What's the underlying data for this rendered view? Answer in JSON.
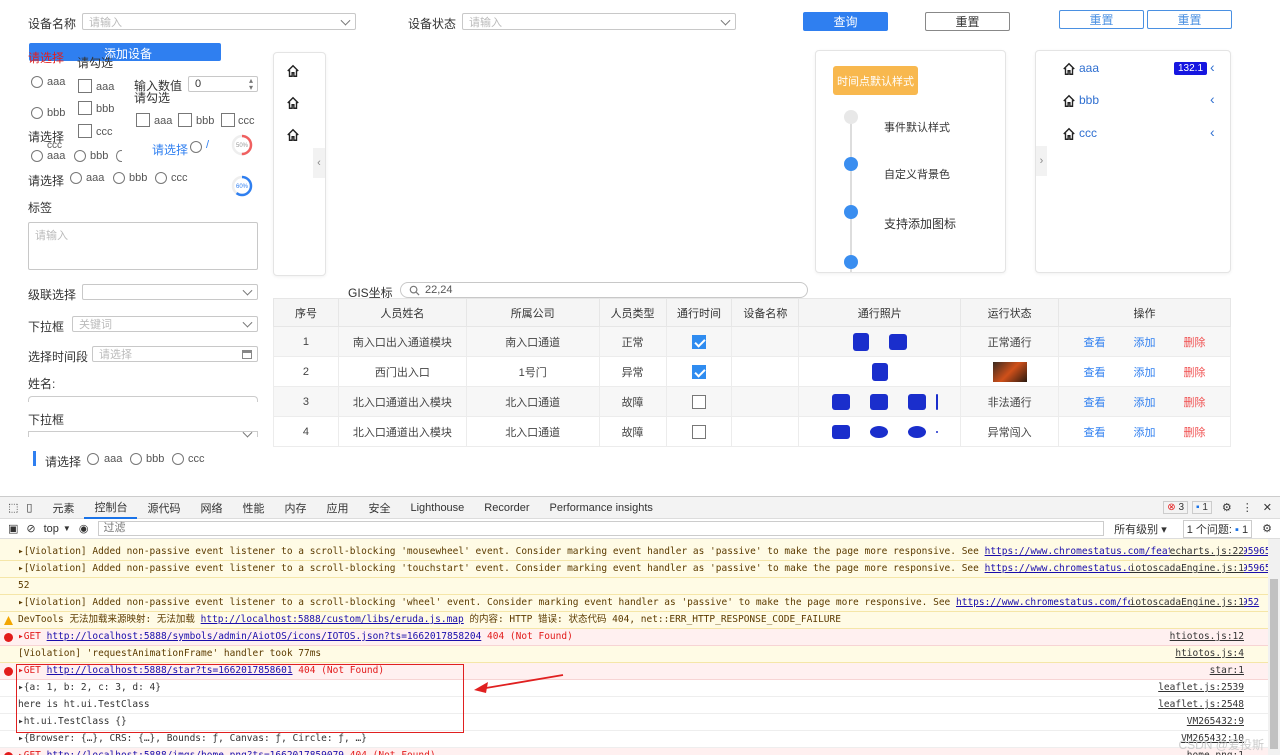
{
  "search": {
    "device_name_label": "设备名称",
    "device_name_placeholder": "请输入",
    "device_status_label": "设备状态",
    "device_status_placeholder": "请输入",
    "query_button": "查询",
    "reset_button": "重置",
    "reset_button_2": "重置",
    "reset_button_3": "重置"
  },
  "form": {
    "select_label_red": "请选择",
    "add_device_button": "添加设备",
    "checkbox_group_label": "请勾选",
    "radio_options": [
      "aaa",
      "bbb"
    ],
    "checkbox_options": [
      "aaa",
      "bbb",
      "ccc"
    ],
    "number_input_label": "输入数值",
    "number_value": "0",
    "checkbox_group_label_2": "请勾选",
    "checkbox_row": [
      "aaa",
      "bbb",
      "ccc"
    ],
    "select_label_2": "请选择",
    "radio_row_a": [
      "ccc",
      "aaa",
      "bbb"
    ],
    "select_link": "请选择",
    "progress_1": "50%",
    "progress_1_value": 50,
    "progress_2": "60%",
    "progress_2_value": 60,
    "select_label_3": "请选择",
    "radio_row_b": [
      "aaa",
      "bbb",
      "ccc"
    ],
    "tag_label": "标签",
    "textarea_placeholder": "请输入",
    "cascade_label": "级联选择",
    "dropdown_label": "下拉框",
    "dropdown_placeholder": "关键词",
    "date_label": "选择时间段",
    "date_placeholder": "请选择",
    "name_label": "姓名:",
    "dropdown_label_2": "下拉框",
    "select_label_4": "请选择",
    "radio_row_c": [
      "aaa",
      "bbb",
      "ccc"
    ]
  },
  "timeline": {
    "tag": "时间点默认样式",
    "items": [
      "事件默认样式",
      "自定义背景色",
      "支持添加图标"
    ],
    "tag_color": "#f8b84e"
  },
  "nav_card": {
    "items": [
      {
        "label": "aaa",
        "badge": "132.1"
      },
      {
        "label": "bbb",
        "badge": ""
      },
      {
        "label": "ccc",
        "badge": ""
      }
    ]
  },
  "gis": {
    "label": "GIS坐标",
    "value": "22,24"
  },
  "table": {
    "headers": [
      "序号",
      "人员姓名",
      "所属公司",
      "人员类型",
      "通行时间",
      "设备名称",
      "通行照片",
      "运行状态",
      "操作"
    ],
    "rows": [
      {
        "no": "1",
        "name": "南入口出入通道模块",
        "company": "南入口通道",
        "type": "正常",
        "checked": true,
        "status": "正常通行"
      },
      {
        "no": "2",
        "name": "西门出入口",
        "company": "1号门",
        "type": "异常",
        "checked": true,
        "status": ""
      },
      {
        "no": "3",
        "name": "北入口通道出入模块",
        "company": "北入口通道",
        "type": "故障",
        "checked": false,
        "status": "非法通行"
      },
      {
        "no": "4",
        "name": "北入口通道出入模块",
        "company": "北入口通道",
        "type": "故障",
        "checked": false,
        "status": "异常闯入"
      }
    ],
    "actions": [
      "查看",
      "添加",
      "删除"
    ]
  },
  "devtools": {
    "tabs": [
      "元素",
      "控制台",
      "源代码",
      "网络",
      "性能",
      "内存",
      "应用",
      "安全",
      "Lighthouse",
      "Recorder",
      "Performance insights"
    ],
    "errors_count": "3",
    "messages_count": "1",
    "context": "top",
    "filter_placeholder": "过滤",
    "levels": "所有级别",
    "issues": "1 个问题:",
    "issues_count": "1",
    "logs": [
      {
        "kind": "warn",
        "text": "▸[Violation] Added non-passive event listener to a scroll-blocking 'mousewheel' event. Consider marking event handler as 'passive' to make the page more responsive. See ",
        "link": "https://www.chromestatus.com/feature/5745543795965952",
        "src": "echarts.js:22"
      },
      {
        "kind": "warn",
        "text": "▸[Violation] Added non-passive event listener to a scroll-blocking 'touchstart' event. Consider marking event handler as 'passive' to make the page more responsive. See ",
        "link": "https://www.chromestatus.com/feature/5745543795965952",
        "src": "iotoscadaEngine.js:1"
      },
      {
        "kind": "warn",
        "text": "52",
        "link": "",
        "src": ""
      },
      {
        "kind": "warn",
        "text": "▸[Violation] Added non-passive event listener to a scroll-blocking 'wheel' event. Consider marking event handler as 'passive' to make the page more responsive. See ",
        "link": "https://www.chromestatus.com/feature/5745543795965952",
        "src": "iotoscadaEngine.js:1"
      },
      {
        "kind": "warn2",
        "text": "DevTools 无法加载来源映射: 无法加载 ",
        "link": "http://localhost:5888/custom/libs/eruda.js.map",
        "tail": " 的内容: HTTP 错误: 状态代码 404, net::ERR_HTTP_RESPONSE_CODE_FAILURE",
        "src": ""
      },
      {
        "kind": "err",
        "text": "▸GET ",
        "link": "http://localhost:5888/symbols/admin/AiotOS/icons/IOTOS.json?ts=1662017858204",
        "tail": " 404 (Not Found)",
        "src": "htiotos.js:12"
      },
      {
        "kind": "warn",
        "text": "[Violation] 'requestAnimationFrame' handler took 77ms",
        "link": "",
        "src": "htiotos.js:4"
      },
      {
        "kind": "err",
        "text": "▸GET ",
        "link": "http://localhost:5888/star?ts=1662017858601",
        "tail": " 404 (Not Found)",
        "src": "star:1"
      },
      {
        "kind": "log",
        "text": "▸{a: 1, b: 2, c: 3, d: 4}",
        "link": "",
        "src": "leaflet.js:2539"
      },
      {
        "kind": "log",
        "text": "here is ht.ui.TestClass",
        "link": "",
        "src": "leaflet.js:2548"
      },
      {
        "kind": "log",
        "text": "▸ht.ui.TestClass {}",
        "link": "",
        "src": "VM265432:9"
      },
      {
        "kind": "log",
        "text": "▸{Browser: {…}, CRS: {…}, Bounds: ƒ, Canvas: ƒ, Circle: ƒ, …}",
        "link": "",
        "src": "VM265432:10"
      },
      {
        "kind": "err",
        "text": "▸GET ",
        "link": "http://localhost:5888/imgs/home.png?ts=1662017859079",
        "tail": " 404 (Not Found)",
        "src": "home.png:1"
      }
    ],
    "watermark": "CSDN @爱投斯"
  }
}
